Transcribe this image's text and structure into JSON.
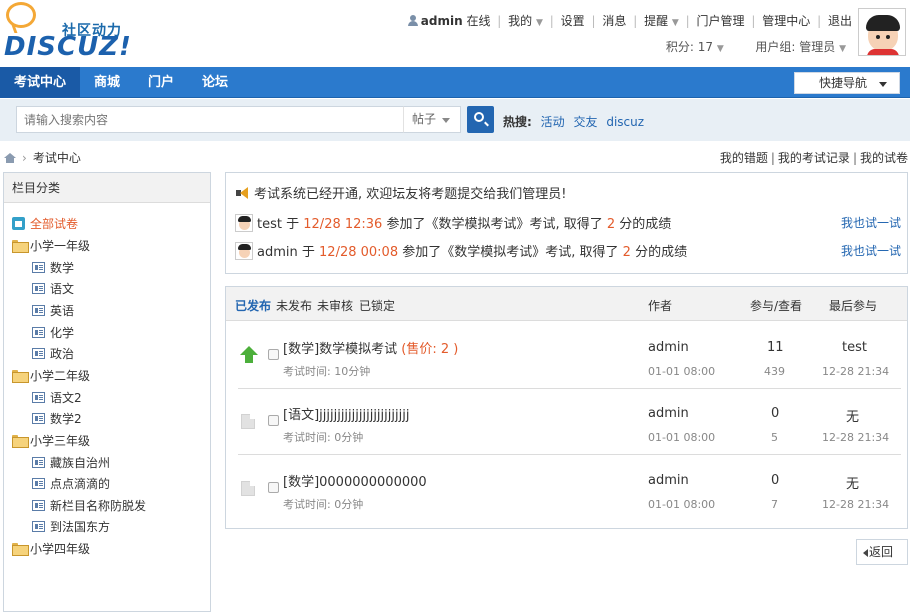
{
  "logo": {
    "sub": "社区动力",
    "main": "DISCUZ!"
  },
  "userbar": {
    "username": "admin",
    "online": "在线",
    "links": [
      "我的",
      "设置",
      "消息",
      "提醒",
      "门户管理",
      "管理中心",
      "退出"
    ],
    "credits": "积分: 17",
    "usergroup": "用户组: 管理员"
  },
  "nav": {
    "items": [
      "考试中心",
      "商城",
      "门户",
      "论坛"
    ],
    "quicknav": "快捷导航"
  },
  "search": {
    "placeholder": "请输入搜索内容",
    "type": "帖子",
    "hot_label": "热搜:",
    "hot_links": [
      "活动",
      "交友",
      "discuz"
    ]
  },
  "breadcrumb": {
    "current": "考试中心"
  },
  "toplinks": [
    "我的错题",
    "我的考试记录",
    "我的试卷"
  ],
  "sidebar": {
    "title": "栏目分类",
    "all": "全部试卷",
    "groups": [
      {
        "label": "小学一年级",
        "items": [
          "数学",
          "语文",
          "英语",
          "化学",
          "政治"
        ]
      },
      {
        "label": "小学二年级",
        "items": [
          "语文2",
          "数学2"
        ]
      },
      {
        "label": "小学三年级",
        "items": [
          "藏族自治州",
          "点点滴滴的",
          "新栏目名称防脱发",
          "到法国东方"
        ]
      },
      {
        "label": "小学四年级",
        "items": []
      }
    ]
  },
  "notice": {
    "title": "考试系统已经开通, 欢迎坛友将考题提交给我们管理员!",
    "rows": [
      {
        "user": "test",
        "at": "于",
        "time": "12/28 12:36",
        "text1": "参加了《数学模拟考试》考试, 取得了",
        "score": "2",
        "text2": "分的成绩",
        "link": "我也试一试"
      },
      {
        "user": "admin",
        "at": "于",
        "time": "12/28 00:08",
        "text1": "参加了《数学模拟考试》考试, 取得了",
        "score": "2",
        "text2": "分的成绩",
        "link": "我也试一试"
      }
    ]
  },
  "exams": {
    "tabs": [
      "已发布",
      "未发布",
      "未审核",
      "已锁定"
    ],
    "columns": {
      "author": "作者",
      "stats": "参与/查看",
      "last": "最后参与"
    },
    "rows": [
      {
        "title": "[数学]数学模拟考试",
        "price": "(售价: 2 )",
        "meta": "考试时间: 10分钟",
        "author": "admin",
        "date": "01-01 08:00",
        "join": "11",
        "views": "439",
        "last_user": "test",
        "last_time": "12-28 21:34",
        "status": "up-icon"
      },
      {
        "title": "[语文]jjjjjjjjjjjjjjjjjjjjjjjjj",
        "price": "",
        "meta": "考试时间: 0分钟",
        "author": "admin",
        "date": "01-01 08:00",
        "join": "0",
        "views": "5",
        "last_user": "无",
        "last_time": "12-28 21:34",
        "status": "doc-icon"
      },
      {
        "title": "[数学]0000000000000",
        "price": "",
        "meta": "考试时间: 0分钟",
        "author": "admin",
        "date": "01-01 08:00",
        "join": "0",
        "views": "7",
        "last_user": "无",
        "last_time": "12-28 21:34",
        "status": "doc-icon"
      }
    ]
  },
  "back": "返回",
  "colors": {
    "nav": "#2b7acd",
    "accent": "#e35b2b",
    "link": "#2366b1"
  }
}
